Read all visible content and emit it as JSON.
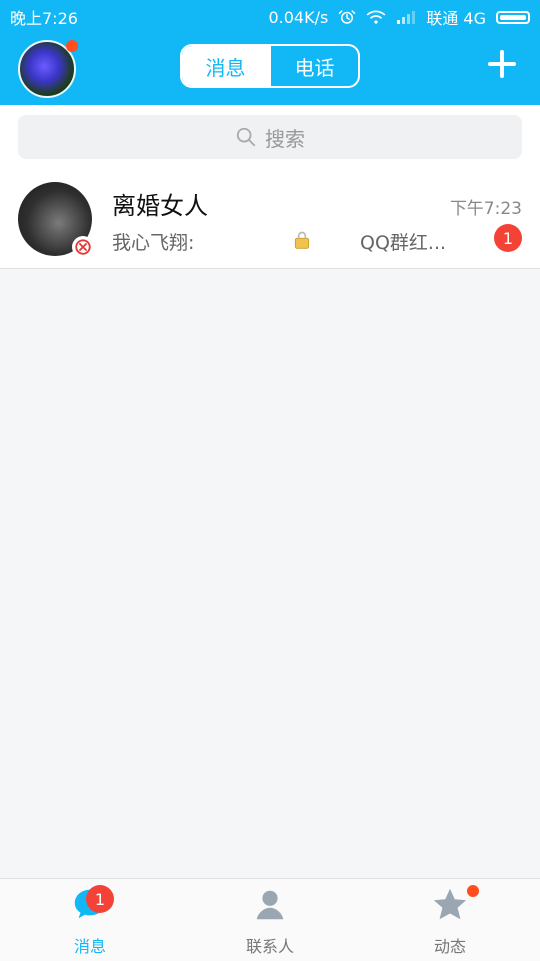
{
  "status_bar": {
    "time": "晚上7:26",
    "speed": "0.04K/s",
    "carrier": "联通 4G"
  },
  "header": {
    "tabs": [
      {
        "label": "消息",
        "active": true
      },
      {
        "label": "电话",
        "active": false
      }
    ]
  },
  "search": {
    "placeholder": "搜索"
  },
  "conversations": [
    {
      "title": "离婚女人",
      "time": "下午7:23",
      "sender": "我心飞翔:",
      "message": "QQ群红...",
      "unread": "1"
    }
  ],
  "tabbar": {
    "items": [
      {
        "label": "消息",
        "badge": "1",
        "active": true
      },
      {
        "label": "联系人"
      },
      {
        "label": "动态",
        "dot": true
      }
    ]
  },
  "colors": {
    "accent": "#12b7f5",
    "badge": "#f44336"
  }
}
